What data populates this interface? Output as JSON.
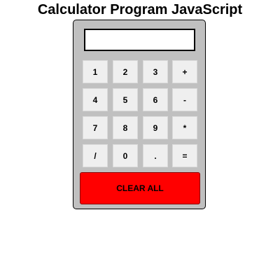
{
  "page": {
    "title": "Calculator Program JavaScript"
  },
  "calculator": {
    "display_value": "",
    "keys": [
      [
        "1",
        "2",
        "3",
        "+"
      ],
      [
        "4",
        "5",
        "6",
        "-"
      ],
      [
        "7",
        "8",
        "9",
        "*"
      ],
      [
        "/",
        "0",
        ".",
        "="
      ]
    ],
    "clear_label": "CLEAR ALL"
  },
  "colors": {
    "body_background": "#c0c0c0",
    "key_background": "#efefef",
    "clear_background": "#ff0000"
  }
}
